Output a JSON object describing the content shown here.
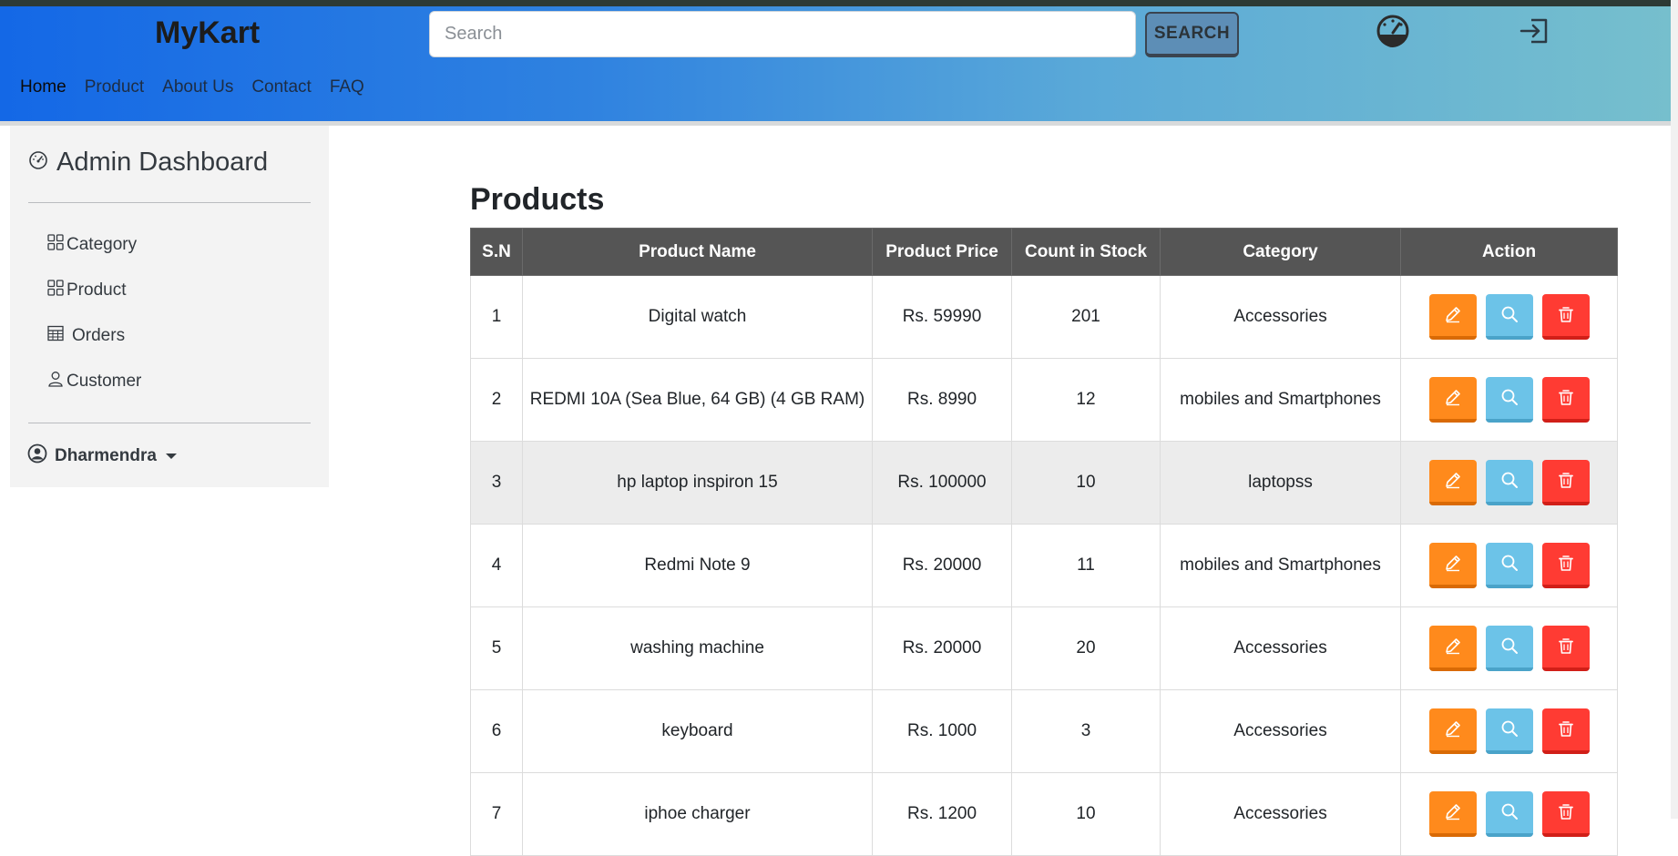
{
  "navbar": {
    "brand": "MyKart",
    "search_placeholder": "Search",
    "search_button": "SEARCH",
    "links": [
      "Home",
      "Product",
      "About Us",
      "Contact",
      "FAQ"
    ],
    "active_link": "Home",
    "icons": [
      "dashboard-gauge-icon",
      "login-icon"
    ]
  },
  "sidebar": {
    "title": "Admin Dashboard",
    "items": [
      {
        "label": "Category",
        "icon": "grid-icon"
      },
      {
        "label": "Product",
        "icon": "grid-icon"
      },
      {
        "label": "Orders",
        "icon": "table-icon"
      },
      {
        "label": "Customer",
        "icon": "person-icon"
      }
    ],
    "user": "Dharmendra"
  },
  "main": {
    "title": "Products",
    "columns": [
      "S.N",
      "Product Name",
      "Product Price",
      "Count in Stock",
      "Category",
      "Action"
    ],
    "rows": [
      {
        "sn": "1",
        "name": "Digital watch",
        "price": "Rs. 59990",
        "stock": "201",
        "category": "Accessories"
      },
      {
        "sn": "2",
        "name": "REDMI 10A (Sea Blue, 64 GB) (4 GB RAM)",
        "price": "Rs. 8990",
        "stock": "12",
        "category": "mobiles and Smartphones"
      },
      {
        "sn": "3",
        "name": "hp laptop inspiron 15",
        "price": "Rs. 100000",
        "stock": "10",
        "category": "laptopss"
      },
      {
        "sn": "4",
        "name": "Redmi Note 9",
        "price": "Rs. 20000",
        "stock": "11",
        "category": "mobiles and Smartphones"
      },
      {
        "sn": "5",
        "name": "washing machine",
        "price": "Rs. 20000",
        "stock": "20",
        "category": "Accessories"
      },
      {
        "sn": "6",
        "name": "keyboard",
        "price": "Rs. 1000",
        "stock": "3",
        "category": "Accessories"
      },
      {
        "sn": "7",
        "name": "iphoe charger",
        "price": "Rs. 1200",
        "stock": "10",
        "category": "Accessories"
      }
    ],
    "highlighted_row": 2,
    "action_icons": [
      "edit-pencil-icon",
      "view-search-icon",
      "delete-trash-icon"
    ]
  },
  "colors": {
    "navbar_start": "#1468e6",
    "navbar_end": "#76bfcd",
    "table_header": "#555555",
    "edit": "#ff8a1c",
    "view": "#6cc3e8",
    "delete": "#ff3b33"
  }
}
